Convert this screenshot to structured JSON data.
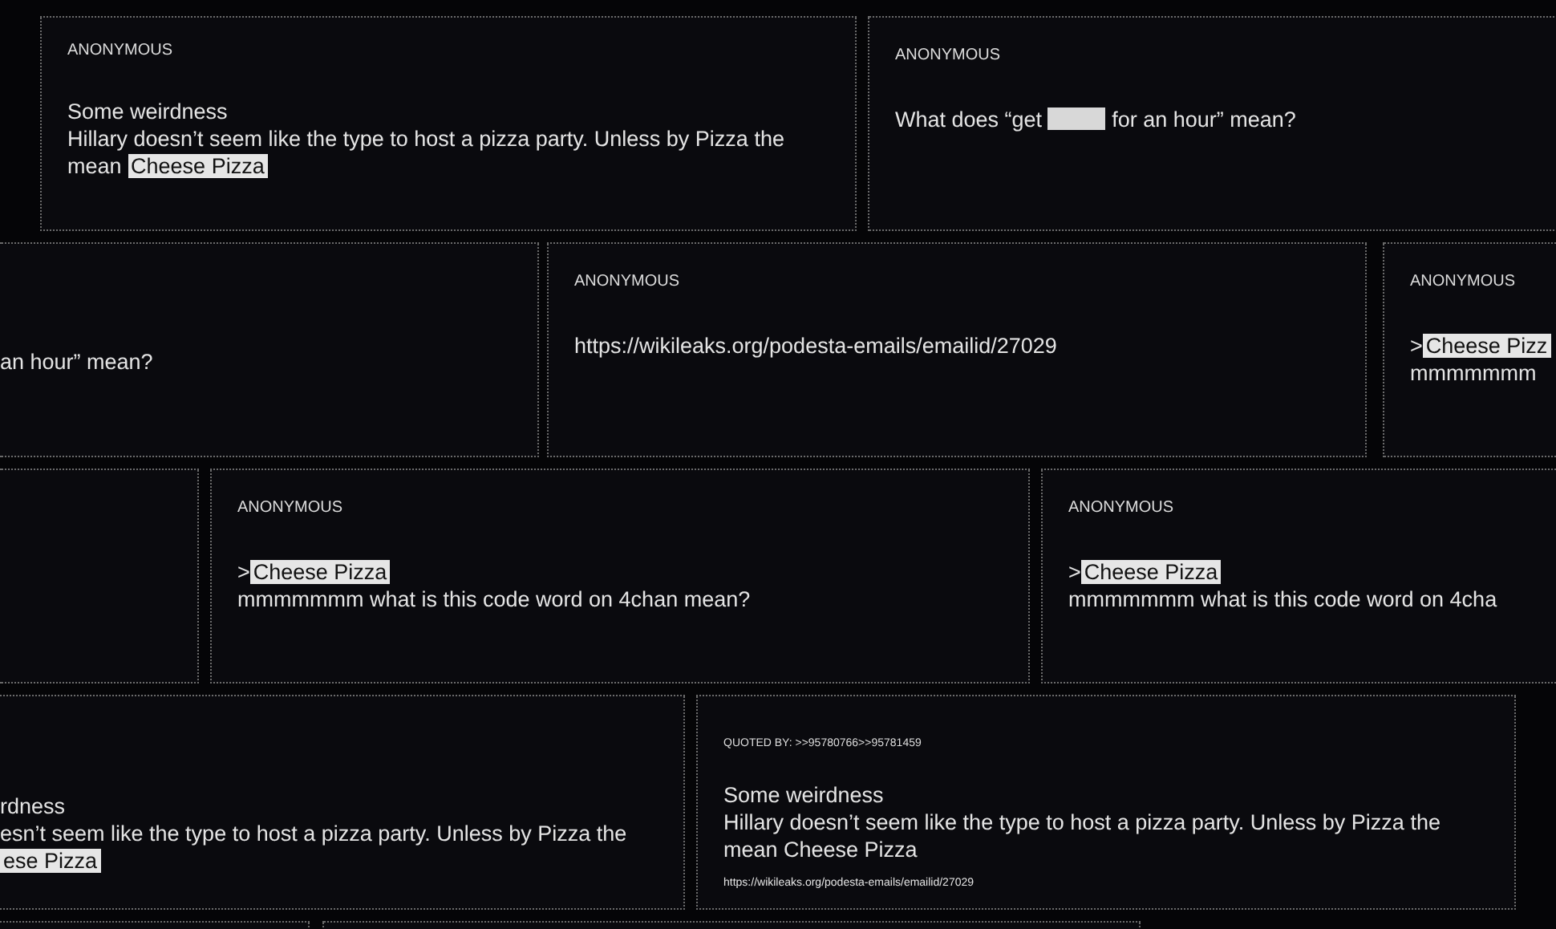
{
  "rows": [
    {
      "cards": [
        {
          "kind": "post",
          "header": "ANONYMOUS",
          "lines": [
            [
              {
                "kind": "plain",
                "text": "Some weirdness"
              }
            ],
            [
              {
                "kind": "plain",
                "text": "Hillary doesn’t seem like the type to host a pizza party. Unless by Pizza the"
              }
            ],
            [
              {
                "kind": "plain",
                "text": "mean "
              },
              {
                "kind": "highlight",
                "text": "Cheese Pizza"
              }
            ]
          ]
        },
        {
          "kind": "post",
          "header": "ANONYMOUS",
          "lines": [
            [
              {
                "kind": "plain",
                "text": "What does “get "
              },
              {
                "kind": "redacted"
              },
              {
                "kind": "plain",
                "text": " for an hour” mean?"
              }
            ]
          ]
        }
      ]
    },
    {
      "cards": [
        {
          "kind": "post",
          "lines": [
            [
              {
                "kind": "plain",
                "text": "an hour” mean?"
              }
            ]
          ]
        },
        {
          "kind": "post",
          "header": "ANONYMOUS",
          "lines": [
            [
              {
                "kind": "plain",
                "text": "https://wikileaks.org/podesta-emails/emailid/27029"
              }
            ]
          ]
        },
        {
          "kind": "post",
          "header": "ANONYMOUS",
          "lines": [
            [
              {
                "kind": "plain",
                "text": ">"
              },
              {
                "kind": "highlight",
                "text": "Cheese Pizz"
              }
            ],
            [
              {
                "kind": "plain",
                "text": "mmmmmmm"
              }
            ]
          ]
        }
      ]
    },
    {
      "cards": [
        {
          "kind": "empty"
        },
        {
          "kind": "post",
          "header": "ANONYMOUS",
          "lines": [
            [
              {
                "kind": "plain",
                "text": ">"
              },
              {
                "kind": "highlight",
                "text": "Cheese Pizza"
              }
            ],
            [
              {
                "kind": "plain",
                "text": "mmmmmmm what is this code word on 4chan mean?"
              }
            ]
          ]
        },
        {
          "kind": "post",
          "header": "ANONYMOUS",
          "lines": [
            [
              {
                "kind": "plain",
                "text": ">"
              },
              {
                "kind": "highlight",
                "text": "Cheese Pizza"
              }
            ],
            [
              {
                "kind": "plain",
                "text": "mmmmmmm what is this code word on 4cha"
              }
            ]
          ]
        }
      ]
    },
    {
      "cards": [
        {
          "kind": "post",
          "lines": [
            [
              {
                "kind": "plain",
                "text": "rdness"
              }
            ],
            [
              {
                "kind": "plain",
                "text": "esn’t seem like the type to host a pizza party. Unless by Pizza the"
              }
            ],
            [
              {
                "kind": "highlight",
                "text": "ese Pizza"
              }
            ]
          ]
        },
        {
          "kind": "post",
          "header": "QUOTED BY: >>95780766>>95781459",
          "lines": [
            [
              {
                "kind": "plain",
                "text": "Some weirdness"
              }
            ],
            [
              {
                "kind": "plain",
                "text": "Hillary doesn’t seem like the type to host a pizza party. Unless by Pizza the"
              }
            ],
            [
              {
                "kind": "plain",
                "text": "mean Cheese Pizza"
              }
            ]
          ],
          "link": "https://wikileaks.org/podesta-emails/emailid/27029"
        }
      ]
    },
    {
      "cards": [
        {
          "kind": "empty"
        },
        {
          "kind": "empty"
        }
      ]
    }
  ]
}
